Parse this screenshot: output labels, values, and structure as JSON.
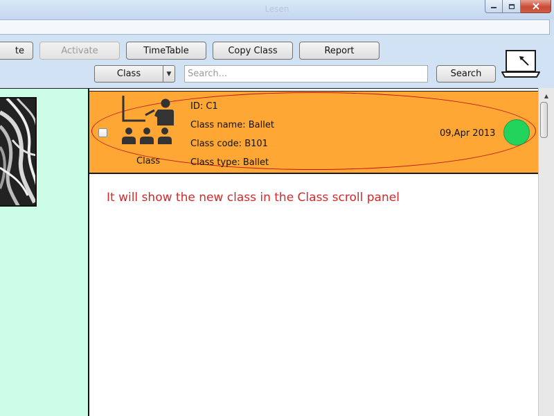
{
  "window": {
    "title": "Lesen"
  },
  "toolbar": {
    "buttons": {
      "update_partial": "te",
      "activate": "Activate",
      "timetable": "TimeTable",
      "copy_class": "Copy Class",
      "report": "Report",
      "search": "Search"
    },
    "filter_select": {
      "selected": "Class"
    },
    "search": {
      "placeholder": "Search...",
      "value": ""
    }
  },
  "class_card": {
    "icon_caption": "Class",
    "id_line": "ID: C1",
    "name_line": "Class name: Ballet",
    "code_line": "Class code: B101",
    "type_line": "Class type: Ballet",
    "date": "09,Apr 2013",
    "status_color": "#22d35c",
    "card_color": "#fea734"
  },
  "annotation": {
    "text": "It will show the new class in the Class scroll panel",
    "color": "#d22a2a"
  },
  "colors": {
    "left_panel": "#ccfde6",
    "toolbar": "#d2e2f5"
  }
}
